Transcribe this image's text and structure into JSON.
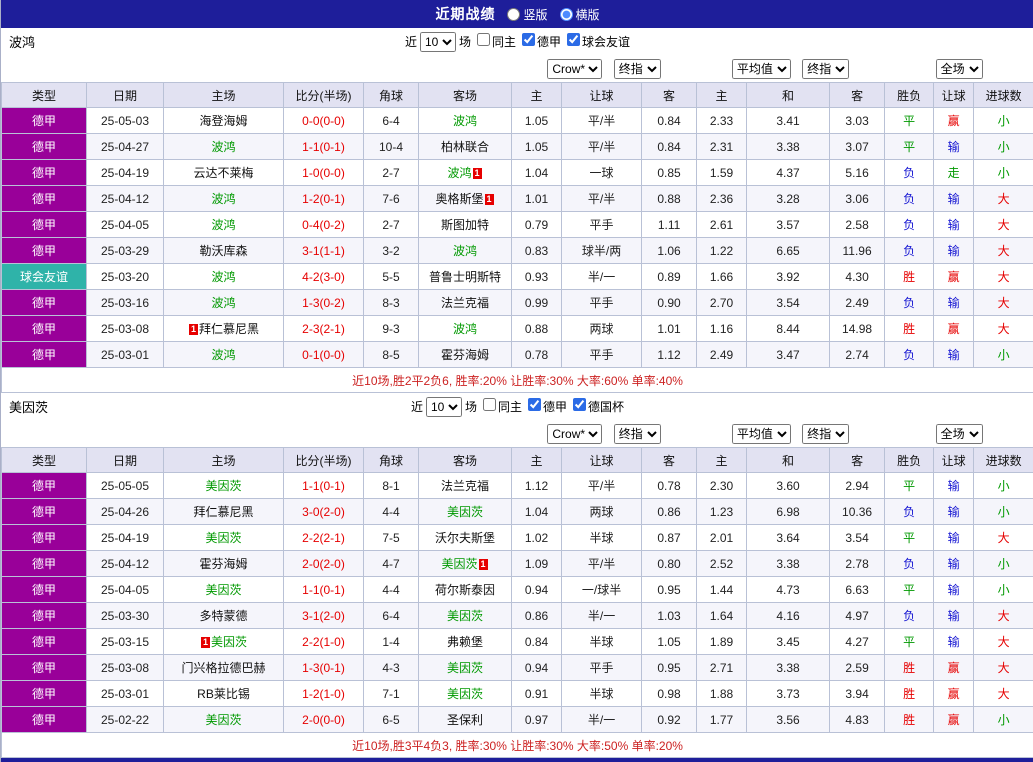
{
  "titlebar": {
    "title": "近期战绩",
    "vertical_label": "竖版",
    "horizontal_label": "横版",
    "selected_layout": "横版"
  },
  "filter": {
    "near_label": "近",
    "games_value": "10",
    "unit_label": "场",
    "same_home_label": "同主"
  },
  "selects": {
    "odds_source": "Crow*",
    "final_odds": "终指",
    "average": "平均值",
    "full_match": "全场"
  },
  "columns": [
    "类型",
    "日期",
    "主场",
    "比分(半场)",
    "角球",
    "客场",
    "主",
    "让球",
    "客",
    "主",
    "和",
    "客",
    "胜负",
    "让球",
    "进球数"
  ],
  "result_colors": {
    "胜": "red",
    "平": "green",
    "负": "blue",
    "赢": "red",
    "输": "blue",
    "走": "green",
    "大": "red",
    "小": "green"
  },
  "colors": {
    "navy": "#1e1e9a",
    "header_bg": "#e2e2f2",
    "grid": "#b9c1d6",
    "league_purple": "#990099",
    "friendly_teal": "#2fb3a9",
    "focus_green": "#009900",
    "score_red": "#e60000",
    "win_red": "#e60000",
    "draw_green": "#009900",
    "lose_blue": "#1414d2",
    "summary_red": "#cc2222",
    "alt_row": "#f5f5fb"
  },
  "sections": [
    {
      "team": "波鸿",
      "league_checkbox": "德甲",
      "extra_checkbox": "球会友谊",
      "summary": "近10场,胜2平2负6, 胜率:20% 让胜率:30% 大率:60% 单率:40%",
      "rows": [
        {
          "league": "德甲",
          "type": "league",
          "date": "25-05-03",
          "home": {
            "name": "海登海姆",
            "focus": false
          },
          "score": "0-0(0-0)",
          "corners": "6-4",
          "away": {
            "name": "波鸿",
            "focus": true
          },
          "odds": [
            "1.05",
            "平/半",
            "0.84"
          ],
          "avg": [
            "2.33",
            "3.41",
            "3.03"
          ],
          "res": [
            "平",
            "赢",
            "小"
          ]
        },
        {
          "league": "德甲",
          "type": "league",
          "date": "25-04-27",
          "home": {
            "name": "波鸿",
            "focus": true
          },
          "score": "1-1(0-1)",
          "corners": "10-4",
          "away": {
            "name": "柏林联合",
            "focus": false
          },
          "odds": [
            "1.05",
            "平/半",
            "0.84"
          ],
          "avg": [
            "2.31",
            "3.38",
            "3.07"
          ],
          "res": [
            "平",
            "输",
            "小"
          ]
        },
        {
          "league": "德甲",
          "type": "league",
          "date": "25-04-19",
          "home": {
            "name": "云达不莱梅",
            "focus": false
          },
          "score": "1-0(0-0)",
          "corners": "2-7",
          "away": {
            "name": "波鸿",
            "focus": true,
            "badge": "1",
            "badge_pos": "after"
          },
          "odds": [
            "1.04",
            "一球",
            "0.85"
          ],
          "avg": [
            "1.59",
            "4.37",
            "5.16"
          ],
          "res": [
            "负",
            "走",
            "小"
          ]
        },
        {
          "league": "德甲",
          "type": "league",
          "date": "25-04-12",
          "home": {
            "name": "波鸿",
            "focus": true
          },
          "score": "1-2(0-1)",
          "corners": "7-6",
          "away": {
            "name": "奥格斯堡",
            "focus": false,
            "badge": "1",
            "badge_pos": "after"
          },
          "odds": [
            "1.01",
            "平/半",
            "0.88"
          ],
          "avg": [
            "2.36",
            "3.28",
            "3.06"
          ],
          "res": [
            "负",
            "输",
            "大"
          ]
        },
        {
          "league": "德甲",
          "type": "league",
          "date": "25-04-05",
          "home": {
            "name": "波鸿",
            "focus": true
          },
          "score": "0-4(0-2)",
          "corners": "2-7",
          "away": {
            "name": "斯图加特",
            "focus": false
          },
          "odds": [
            "0.79",
            "平手",
            "1.11"
          ],
          "avg": [
            "2.61",
            "3.57",
            "2.58"
          ],
          "res": [
            "负",
            "输",
            "大"
          ]
        },
        {
          "league": "德甲",
          "type": "league",
          "date": "25-03-29",
          "home": {
            "name": "勒沃库森",
            "focus": false
          },
          "score": "3-1(1-1)",
          "corners": "3-2",
          "away": {
            "name": "波鸿",
            "focus": true
          },
          "odds": [
            "0.83",
            "球半/两",
            "1.06"
          ],
          "avg": [
            "1.22",
            "6.65",
            "11.96"
          ],
          "res": [
            "负",
            "输",
            "大"
          ]
        },
        {
          "league": "球会友谊",
          "type": "friendly",
          "date": "25-03-20",
          "home": {
            "name": "波鸿",
            "focus": true
          },
          "score": "4-2(3-0)",
          "corners": "5-5",
          "away": {
            "name": "普鲁士明斯特",
            "focus": false
          },
          "odds": [
            "0.93",
            "半/一",
            "0.89"
          ],
          "avg": [
            "1.66",
            "3.92",
            "4.30"
          ],
          "res": [
            "胜",
            "赢",
            "大"
          ]
        },
        {
          "league": "德甲",
          "type": "league",
          "date": "25-03-16",
          "home": {
            "name": "波鸿",
            "focus": true
          },
          "score": "1-3(0-2)",
          "corners": "8-3",
          "away": {
            "name": "法兰克福",
            "focus": false
          },
          "odds": [
            "0.99",
            "平手",
            "0.90"
          ],
          "avg": [
            "2.70",
            "3.54",
            "2.49"
          ],
          "res": [
            "负",
            "输",
            "大"
          ]
        },
        {
          "league": "德甲",
          "type": "league",
          "date": "25-03-08",
          "home": {
            "name": "拜仁慕尼黑",
            "focus": false,
            "badge": "1",
            "badge_pos": "before"
          },
          "score": "2-3(2-1)",
          "corners": "9-3",
          "away": {
            "name": "波鸿",
            "focus": true
          },
          "odds": [
            "0.88",
            "两球",
            "1.01"
          ],
          "avg": [
            "1.16",
            "8.44",
            "14.98"
          ],
          "res": [
            "胜",
            "赢",
            "大"
          ]
        },
        {
          "league": "德甲",
          "type": "league",
          "date": "25-03-01",
          "home": {
            "name": "波鸿",
            "focus": true
          },
          "score": "0-1(0-0)",
          "corners": "8-5",
          "away": {
            "name": "霍芬海姆",
            "focus": false
          },
          "odds": [
            "0.78",
            "平手",
            "1.12"
          ],
          "avg": [
            "2.49",
            "3.47",
            "2.74"
          ],
          "res": [
            "负",
            "输",
            "小"
          ]
        }
      ]
    },
    {
      "team": "美因茨",
      "league_checkbox": "德甲",
      "extra_checkbox": "德国杯",
      "summary": "近10场,胜3平4负3, 胜率:30% 让胜率:30% 大率:50% 单率:20%",
      "rows": [
        {
          "league": "德甲",
          "type": "league",
          "date": "25-05-05",
          "home": {
            "name": "美因茨",
            "focus": true
          },
          "score": "1-1(0-1)",
          "corners": "8-1",
          "away": {
            "name": "法兰克福",
            "focus": false
          },
          "odds": [
            "1.12",
            "平/半",
            "0.78"
          ],
          "avg": [
            "2.30",
            "3.60",
            "2.94"
          ],
          "res": [
            "平",
            "输",
            "小"
          ]
        },
        {
          "league": "德甲",
          "type": "league",
          "date": "25-04-26",
          "home": {
            "name": "拜仁慕尼黑",
            "focus": false
          },
          "score": "3-0(2-0)",
          "corners": "4-4",
          "away": {
            "name": "美因茨",
            "focus": true
          },
          "odds": [
            "1.04",
            "两球",
            "0.86"
          ],
          "avg": [
            "1.23",
            "6.98",
            "10.36"
          ],
          "res": [
            "负",
            "输",
            "小"
          ]
        },
        {
          "league": "德甲",
          "type": "league",
          "date": "25-04-19",
          "home": {
            "name": "美因茨",
            "focus": true
          },
          "score": "2-2(2-1)",
          "corners": "7-5",
          "away": {
            "name": "沃尔夫斯堡",
            "focus": false
          },
          "odds": [
            "1.02",
            "半球",
            "0.87"
          ],
          "avg": [
            "2.01",
            "3.64",
            "3.54"
          ],
          "res": [
            "平",
            "输",
            "大"
          ]
        },
        {
          "league": "德甲",
          "type": "league",
          "date": "25-04-12",
          "home": {
            "name": "霍芬海姆",
            "focus": false
          },
          "score": "2-0(2-0)",
          "corners": "4-7",
          "away": {
            "name": "美因茨",
            "focus": true,
            "badge": "1",
            "badge_pos": "after"
          },
          "odds": [
            "1.09",
            "平/半",
            "0.80"
          ],
          "avg": [
            "2.52",
            "3.38",
            "2.78"
          ],
          "res": [
            "负",
            "输",
            "小"
          ]
        },
        {
          "league": "德甲",
          "type": "league",
          "date": "25-04-05",
          "home": {
            "name": "美因茨",
            "focus": true
          },
          "score": "1-1(0-1)",
          "corners": "4-4",
          "away": {
            "name": "荷尔斯泰因",
            "focus": false
          },
          "odds": [
            "0.94",
            "一/球半",
            "0.95"
          ],
          "avg": [
            "1.44",
            "4.73",
            "6.63"
          ],
          "res": [
            "平",
            "输",
            "小"
          ]
        },
        {
          "league": "德甲",
          "type": "league",
          "date": "25-03-30",
          "home": {
            "name": "多特蒙德",
            "focus": false
          },
          "score": "3-1(2-0)",
          "corners": "6-4",
          "away": {
            "name": "美因茨",
            "focus": true
          },
          "odds": [
            "0.86",
            "半/一",
            "1.03"
          ],
          "avg": [
            "1.64",
            "4.16",
            "4.97"
          ],
          "res": [
            "负",
            "输",
            "大"
          ]
        },
        {
          "league": "德甲",
          "type": "league",
          "date": "25-03-15",
          "home": {
            "name": "美因茨",
            "focus": true,
            "badge": "1",
            "badge_pos": "before"
          },
          "score": "2-2(1-0)",
          "corners": "1-4",
          "away": {
            "name": "弗赖堡",
            "focus": false
          },
          "odds": [
            "0.84",
            "半球",
            "1.05"
          ],
          "avg": [
            "1.89",
            "3.45",
            "4.27"
          ],
          "res": [
            "平",
            "输",
            "大"
          ]
        },
        {
          "league": "德甲",
          "type": "league",
          "date": "25-03-08",
          "home": {
            "name": "门兴格拉德巴赫",
            "focus": false
          },
          "score": "1-3(0-1)",
          "corners": "4-3",
          "away": {
            "name": "美因茨",
            "focus": true
          },
          "odds": [
            "0.94",
            "平手",
            "0.95"
          ],
          "avg": [
            "2.71",
            "3.38",
            "2.59"
          ],
          "res": [
            "胜",
            "赢",
            "大"
          ]
        },
        {
          "league": "德甲",
          "type": "league",
          "date": "25-03-01",
          "home": {
            "name": "RB莱比锡",
            "focus": false
          },
          "score": "1-2(1-0)",
          "corners": "7-1",
          "away": {
            "name": "美因茨",
            "focus": true
          },
          "odds": [
            "0.91",
            "半球",
            "0.98"
          ],
          "avg": [
            "1.88",
            "3.73",
            "3.94"
          ],
          "res": [
            "胜",
            "赢",
            "大"
          ]
        },
        {
          "league": "德甲",
          "type": "league",
          "date": "25-02-22",
          "home": {
            "name": "美因茨",
            "focus": true
          },
          "score": "2-0(0-0)",
          "corners": "6-5",
          "away": {
            "name": "圣保利",
            "focus": false
          },
          "odds": [
            "0.97",
            "半/一",
            "0.92"
          ],
          "avg": [
            "1.77",
            "3.56",
            "4.83"
          ],
          "res": [
            "胜",
            "赢",
            "小"
          ]
        }
      ]
    }
  ]
}
